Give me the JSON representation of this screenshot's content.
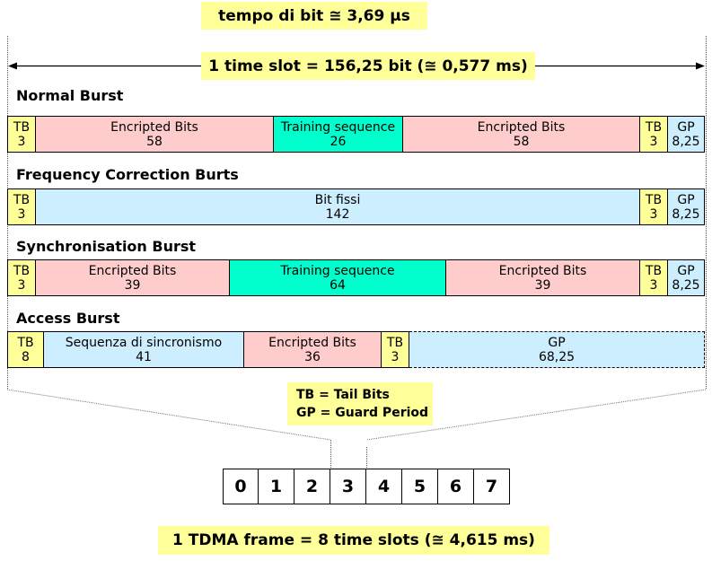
{
  "header": {
    "bit_time": "tempo di bit ≅ 3,69 μs",
    "time_slot": "1 time slot = 156,25 bit (≅ 0,577 ms)"
  },
  "colors": {
    "tail_bits": "#ffff99",
    "encrypted": "#ffcccc",
    "training": "#00ffcc",
    "guard": "#cceeff",
    "note": "#ffff99"
  },
  "bursts": [
    {
      "title": "Normal Burst",
      "segments": [
        {
          "label": "TB",
          "value": "3",
          "type": "tb"
        },
        {
          "label": "Encripted Bits",
          "value": "58",
          "type": "enc"
        },
        {
          "label": "Training sequence",
          "value": "26",
          "type": "train"
        },
        {
          "label": "Encripted Bits",
          "value": "58",
          "type": "enc"
        },
        {
          "label": "TB",
          "value": "3",
          "type": "tb"
        },
        {
          "label": "GP",
          "value": "8,25",
          "type": "gp"
        }
      ]
    },
    {
      "title": "Frequency Correction Burts",
      "segments": [
        {
          "label": "TB",
          "value": "3",
          "type": "tb"
        },
        {
          "label": "Bit fissi",
          "value": "142",
          "type": "fix"
        },
        {
          "label": "TB",
          "value": "3",
          "type": "tb"
        },
        {
          "label": "GP",
          "value": "8,25",
          "type": "gp"
        }
      ]
    },
    {
      "title": "Synchronisation Burst",
      "segments": [
        {
          "label": "TB",
          "value": "3",
          "type": "tb"
        },
        {
          "label": "Encripted Bits",
          "value": "39",
          "type": "enc"
        },
        {
          "label": "Training sequence",
          "value": "64",
          "type": "train"
        },
        {
          "label": "Encripted Bits",
          "value": "39",
          "type": "enc"
        },
        {
          "label": "TB",
          "value": "3",
          "type": "tb"
        },
        {
          "label": "GP",
          "value": "8,25",
          "type": "gp"
        }
      ]
    },
    {
      "title": "Access Burst",
      "segments": [
        {
          "label": "TB",
          "value": "8",
          "type": "tb"
        },
        {
          "label": "Sequenza di sincronismo",
          "value": "41",
          "type": "fix"
        },
        {
          "label": "Encripted Bits",
          "value": "36",
          "type": "enc"
        },
        {
          "label": "TB",
          "value": "3",
          "type": "tb"
        },
        {
          "label": "GP",
          "value": "68,25",
          "type": "gp",
          "dashed": true
        }
      ]
    }
  ],
  "legend": {
    "line1": "TB = Tail Bits",
    "line2": "GP = Guard Period"
  },
  "frame": {
    "slots": [
      "0",
      "1",
      "2",
      "3",
      "4",
      "5",
      "6",
      "7"
    ],
    "highlighted_slot": "3",
    "caption": "1 TDMA frame = 8 time slots (≅ 4,615 ms)"
  }
}
